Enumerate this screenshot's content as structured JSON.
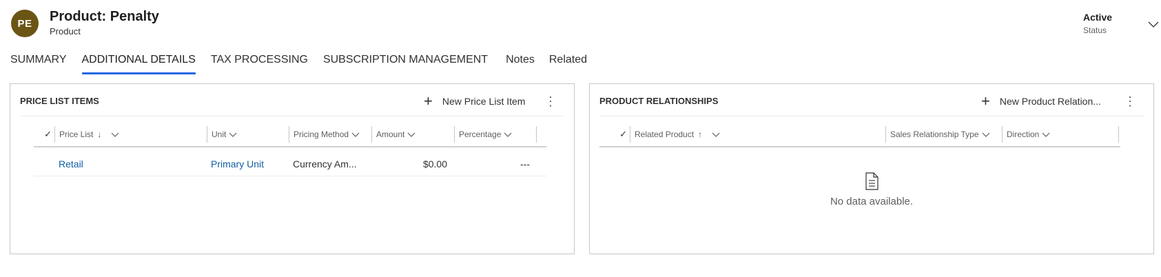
{
  "header": {
    "avatar_initials": "PE",
    "avatar_color": "#6b5514",
    "title": "Product: Penalty",
    "subtitle": "Product",
    "status_value": "Active",
    "status_label": "Status"
  },
  "tabs": [
    {
      "label": "SUMMARY",
      "active": false
    },
    {
      "label": "ADDITIONAL DETAILS",
      "active": true
    },
    {
      "label": "TAX PROCESSING",
      "active": false
    },
    {
      "label": "SUBSCRIPTION MANAGEMENT",
      "active": false
    },
    {
      "label": "Notes",
      "active": false
    },
    {
      "label": "Related",
      "active": false
    }
  ],
  "price_list_items": {
    "title": "PRICE LIST ITEMS",
    "new_label": "New Price List Item",
    "columns": [
      {
        "label": "Price List",
        "sort": "↓"
      },
      {
        "label": "Unit"
      },
      {
        "label": "Pricing Method"
      },
      {
        "label": "Amount"
      },
      {
        "label": "Percentage"
      }
    ],
    "rows": [
      {
        "price_list": "Retail",
        "unit": "Primary Unit",
        "pricing_method": "Currency Am...",
        "amount": "$0.00",
        "percentage": "---"
      }
    ]
  },
  "product_relationships": {
    "title": "PRODUCT RELATIONSHIPS",
    "new_label": "New Product Relation...",
    "columns": [
      {
        "label": "Related Product",
        "sort": "↑"
      },
      {
        "label": "Sales Relationship Type"
      },
      {
        "label": "Direction"
      }
    ],
    "empty_text": "No data available."
  },
  "accent_color": "#2266e3",
  "link_color": "#115ea3"
}
